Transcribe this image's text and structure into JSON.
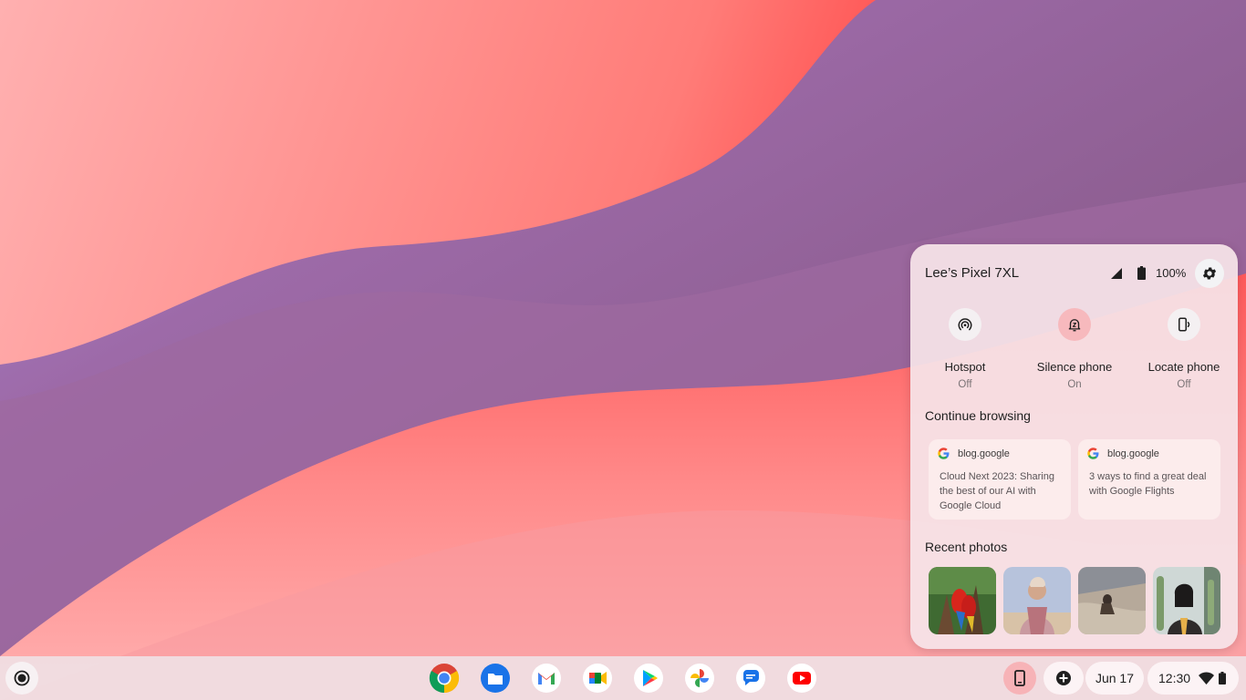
{
  "phone_hub": {
    "device_name": "Lee’s Pixel 7XL",
    "battery": "100%",
    "quick_actions": [
      {
        "label": "Hotspot",
        "state": "Off"
      },
      {
        "label": "Silence phone",
        "state": "On"
      },
      {
        "label": "Locate phone",
        "state": "Off"
      }
    ],
    "continue_browsing_title": "Continue browsing",
    "browsing_cards": [
      {
        "domain": "blog.google",
        "title": "Cloud Next 2023: Sharing the best of our AI with Google Cloud"
      },
      {
        "domain": "blog.google",
        "title": "3 ways to find a great deal with Google Flights"
      }
    ],
    "recent_photos_title": "Recent photos",
    "photos": [
      "macaws",
      "person-with-scarf",
      "beach-sand",
      "person-with-cactus"
    ]
  },
  "shelf": {
    "apps": [
      "chrome",
      "files",
      "gmail",
      "meet",
      "play-store",
      "photos",
      "messages",
      "youtube"
    ],
    "date": "Jun 17",
    "time": "12:30"
  },
  "colors": {
    "accent": "#f7b3b7",
    "panel": "#f6e4e8"
  }
}
